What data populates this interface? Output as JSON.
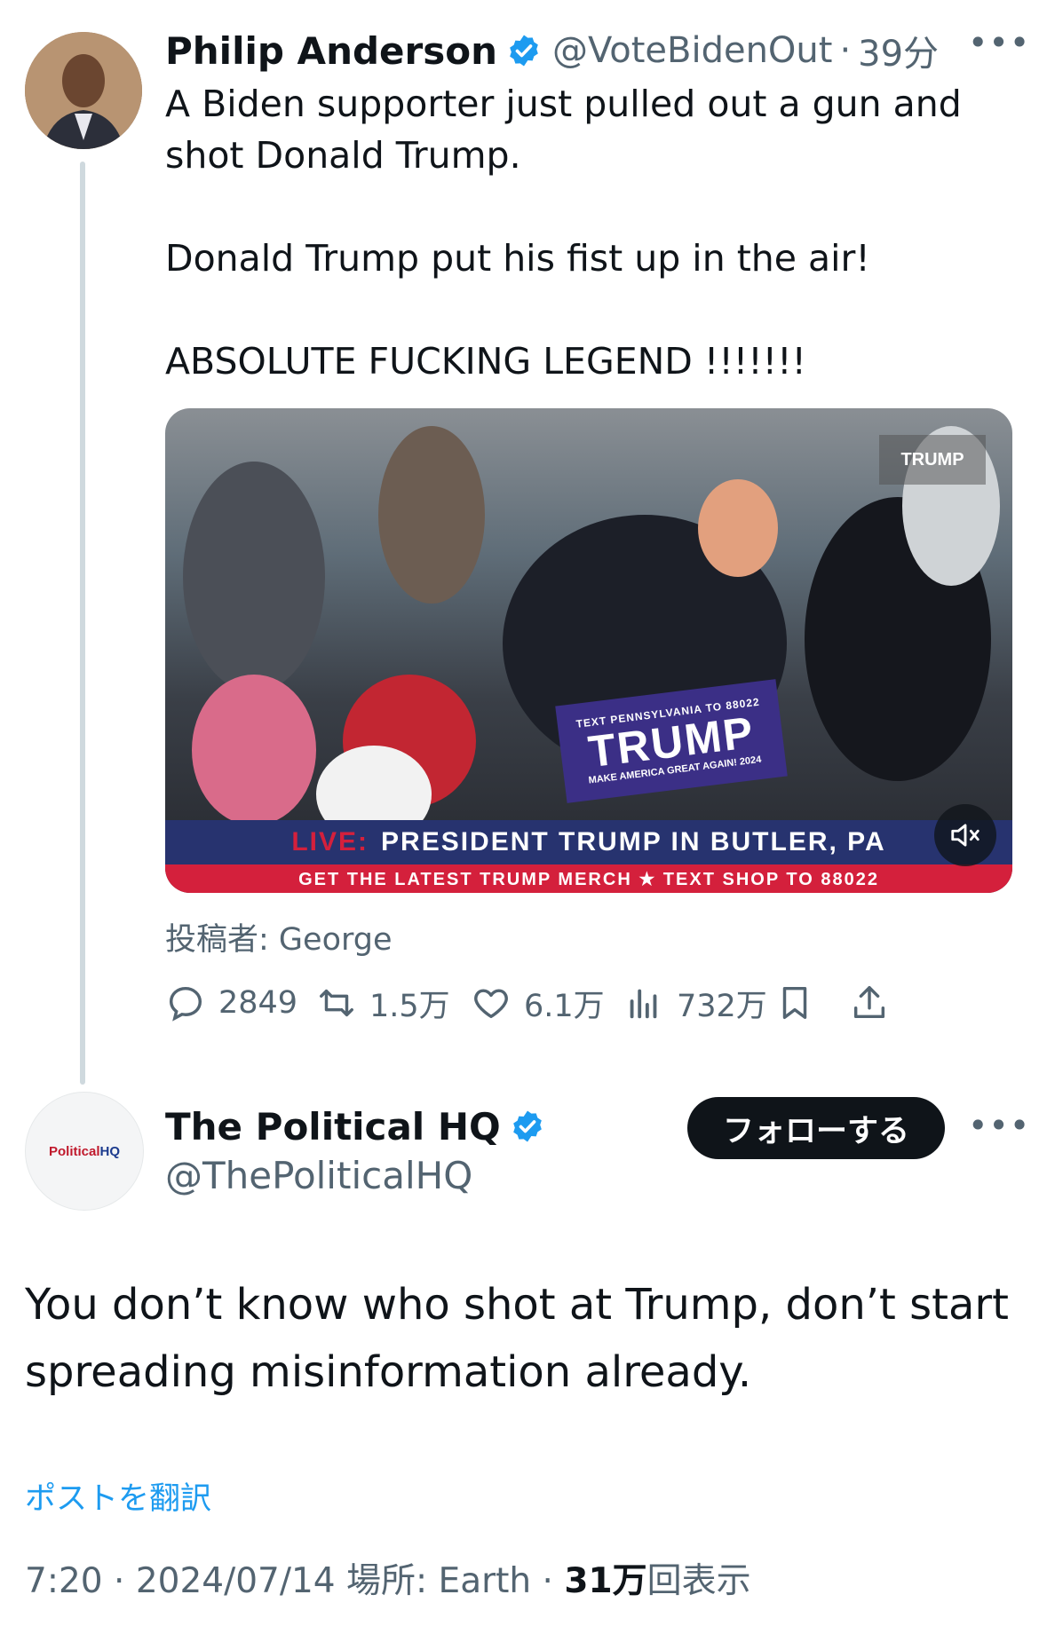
{
  "parent_tweet": {
    "author_name": "Philip Anderson",
    "handle": "@VoteBidenOut",
    "separator": "·",
    "time_ago": "39分",
    "body_lines": [
      "A Biden supporter just pulled out a gun and shot Donald Trump.",
      "Donald Trump put his fist up in the air!",
      "ABSOLUTE FUCKING LEGEND !!!!!!!"
    ],
    "media": {
      "corner_bug": "TRUMP",
      "sign_top": "TEXT PENNSYLVANIA TO 88022",
      "sign_main": "TRUMP",
      "sign_bottom": "MAKE AMERICA GREAT AGAIN! 2024",
      "banner_live": "LIVE:",
      "banner_text": "PRESIDENT TRUMP IN BUTLER, PA",
      "ticker_text": "GET THE LATEST TRUMP MERCH ★ TEXT SHOP TO 88022"
    },
    "posted_by": "投稿者: George",
    "actions": {
      "replies": "2849",
      "reposts": "1.5万",
      "likes": "6.1万",
      "views": "732万"
    }
  },
  "reply_tweet": {
    "author_name": "The Political HQ",
    "handle": "@ThePoliticalHQ",
    "avatar_text_a": "Political",
    "avatar_text_b": "HQ",
    "follow_label": "フォローする",
    "body": "You don’t know who shot at Trump, don’t start spreading misinformation already.",
    "translate_label": "ポストを翻訳",
    "time": "7:20",
    "date": "2024/07/14",
    "location": "場所: Earth",
    "views_count": "31万",
    "views_label": "回表示",
    "dot": "·"
  },
  "colors": {
    "verified": "#1d9bf0",
    "link": "#1d9bf0",
    "muted_text": "#536471",
    "banner_blue": "#27336f",
    "ticker_red": "#d4203c"
  },
  "icons": [
    "verified-badge-icon",
    "more-icon",
    "reply-icon",
    "repost-icon",
    "like-icon",
    "views-icon",
    "bookmark-icon",
    "share-icon",
    "mute-icon"
  ]
}
